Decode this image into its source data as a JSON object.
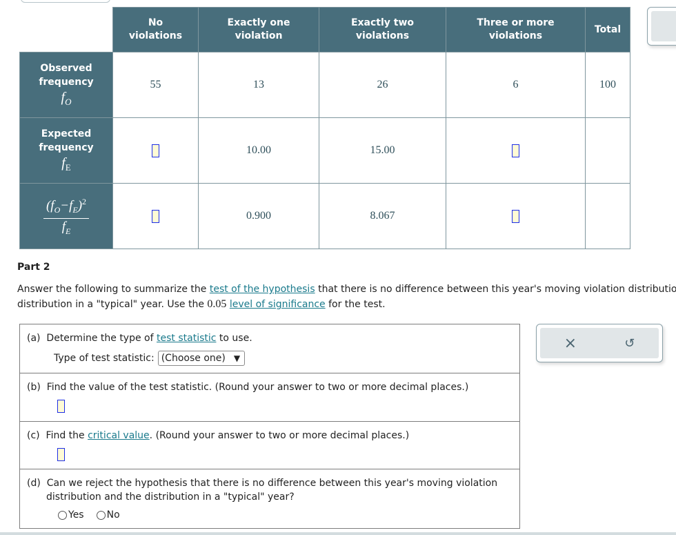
{
  "table": {
    "columns": [
      "No violations",
      "Exactly one violation",
      "Exactly two violations",
      "Three or more violations",
      "Total"
    ],
    "column_lines": [
      [
        "No",
        "violations"
      ],
      [
        "Exactly one",
        "violation"
      ],
      [
        "Exactly two",
        "violations"
      ],
      [
        "Three or more",
        "violations"
      ],
      [
        "Total"
      ]
    ],
    "rows": [
      {
        "label_lines": [
          "Observed",
          "frequency"
        ],
        "symbol": "f",
        "symbol_sub": "O",
        "cells": [
          "55",
          "13",
          "26",
          "6",
          "100"
        ]
      },
      {
        "label_lines": [
          "Expected",
          "frequency"
        ],
        "symbol": "f",
        "symbol_sub": "E",
        "cells": [
          "",
          "10.00",
          "15.00",
          "",
          ""
        ],
        "input_cells": [
          0,
          3
        ]
      },
      {
        "label_formula": {
          "numerator": "(fO − fE)²",
          "denominator": "fE"
        },
        "cells": [
          "",
          "0.900",
          "8.067",
          "",
          ""
        ],
        "input_cells": [
          0,
          3
        ]
      }
    ]
  },
  "part2": {
    "title": "Part 2",
    "intro_1a": "Answer the following to summarize the ",
    "intro_link1": "test of the hypothesis",
    "intro_1b": " that there is no difference between this year's moving violation distribution and the",
    "intro_2a": "distribution in a \"typical\" year. Use the ",
    "significance": "0.05",
    "intro_link2": "level of significance",
    "intro_2b": " for the test."
  },
  "questions": {
    "a": {
      "prefix": "(a)",
      "text_a": "Determine the type of ",
      "link": "test statistic",
      "text_b": " to use.",
      "select_label": "Type of test statistic:",
      "select_value": "(Choose one)",
      "select_arrow": "▼"
    },
    "b": {
      "prefix": "(b)",
      "text": "Find the value of the test statistic. (Round your answer to two or more decimal places.)"
    },
    "c": {
      "prefix": "(c)",
      "text_a": "Find the ",
      "link": "critical value",
      "text_b": ". (Round your answer to two or more decimal places.)"
    },
    "d": {
      "prefix": "(d)",
      "line1": "Can we reject the hypothesis that there is no difference between this year's moving violation",
      "line2": "distribution and the distribution in a \"typical\" year?",
      "options": [
        "Yes",
        "No"
      ]
    }
  },
  "tools": {
    "clear_icon": "×",
    "undo_icon": "↺"
  },
  "colors": {
    "header_bg": "#486e7c",
    "link": "#1a7a8c",
    "input_border": "#1d2ee6",
    "input_bg": "#fffbd6"
  }
}
